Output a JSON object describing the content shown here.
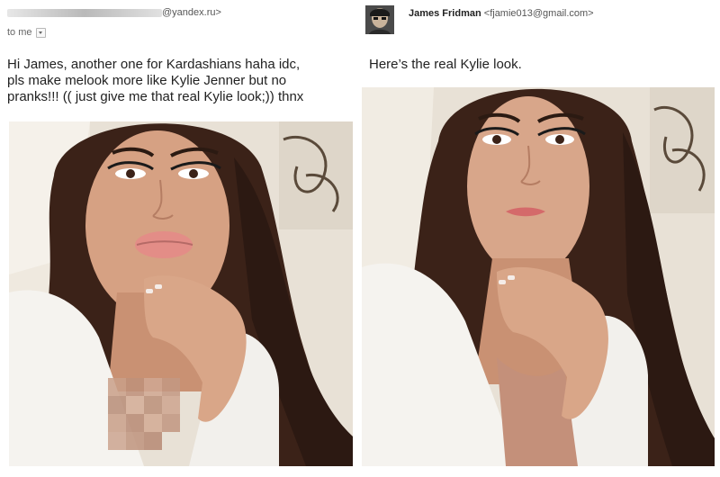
{
  "left_email": {
    "sender_suffix": "@yandex.ru>",
    "to_label": "to me",
    "message": "Hi James, another one for Kardashians haha idc,\npls make melook more like Kylie Jenner but no\npranks!!! (( just give me that real Kylie look;)) thnx"
  },
  "right_email": {
    "from_name": "James Fridman",
    "from_address": "<fjamie013@gmail.com>",
    "message": "Here’s the real Kylie look."
  },
  "colors": {
    "text": "#222222",
    "muted": "#666666",
    "hair": "#3b2218",
    "skin": "#d6a183",
    "top": "#f5f3ef"
  }
}
